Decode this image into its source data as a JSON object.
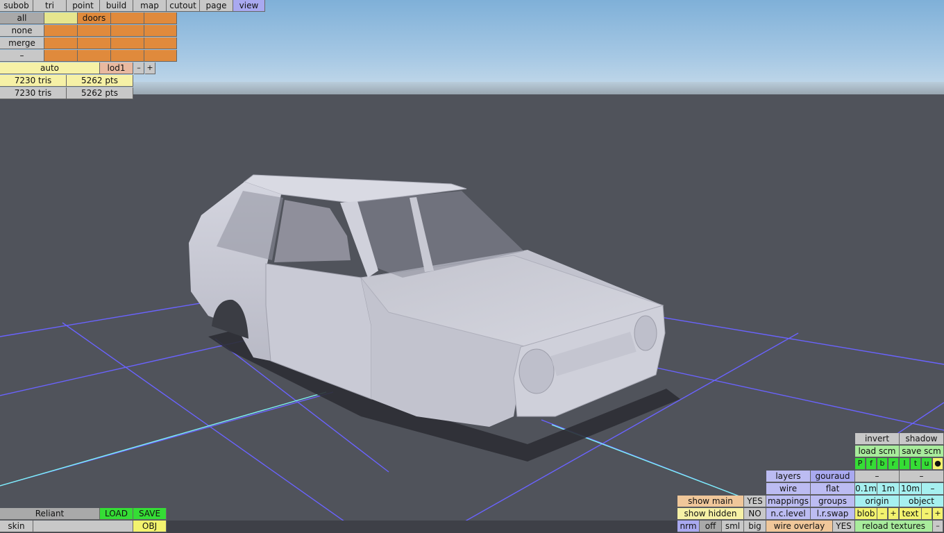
{
  "menu": {
    "tabs": [
      "subob",
      "tri",
      "point",
      "build",
      "map",
      "cutout",
      "page",
      "view"
    ],
    "active": "view"
  },
  "groups": {
    "rows": [
      {
        "label": "all",
        "cells": [
          "",
          "doors",
          "",
          "",
          ""
        ]
      },
      {
        "label": "none",
        "cells": [
          "",
          "",
          "",
          "",
          ""
        ]
      },
      {
        "label": "merge",
        "cells": [
          "",
          "",
          "",
          "",
          ""
        ]
      },
      {
        "label": "–",
        "cells": [
          "",
          "",
          "",
          "",
          ""
        ]
      }
    ]
  },
  "lod": {
    "mode": "auto",
    "level": "lod1",
    "minus": "–",
    "plus": "+"
  },
  "stats": [
    {
      "tris": "7230 tris",
      "pts": "5262 pts"
    },
    {
      "tris": "7230 tris",
      "pts": "5262 pts"
    }
  ],
  "file": {
    "name": "Reliant",
    "load": "LOAD",
    "save": "SAVE",
    "skin": "skin",
    "skin_value": "",
    "format": "OBJ"
  },
  "right_panel": {
    "invert": "invert",
    "shadow": "shadow",
    "load_scm": "load scm",
    "save_scm": "save scm",
    "flags": [
      "P",
      "f",
      "b",
      "r",
      "l",
      "t",
      "u",
      "●"
    ],
    "layers": "layers",
    "gouraud": "gouraud",
    "dash1": "–",
    "dash2": "–",
    "wire": "wire",
    "flat": "flat",
    "scale": [
      "0.1m",
      "1m",
      "10m",
      "–"
    ],
    "show_main": "show main",
    "show_main_value": "YES",
    "mappings": "mappings",
    "groups": "groups",
    "origin": "origin",
    "object": "object",
    "show_hidden": "show hidden",
    "show_hidden_value": "NO",
    "nc_level": "n.c.level",
    "lr_swap": "l.r.swap",
    "blob": "blob",
    "blob_minus": "–",
    "blob_plus": "+",
    "text": "text",
    "text_minus": "–",
    "text_plus": "+",
    "normals": [
      "nrm",
      "off",
      "sml",
      "big"
    ],
    "wire_overlay": "wire overlay",
    "wire_overlay_value": "YES",
    "reload_textures": "reload textures",
    "reload_dash": "–"
  },
  "colors": {
    "sky": "#8fbbe0",
    "ground": "#50535b",
    "grid": "#6a63ff",
    "grid_axis": "#7ff4f4",
    "car": "#c6c7d2"
  }
}
